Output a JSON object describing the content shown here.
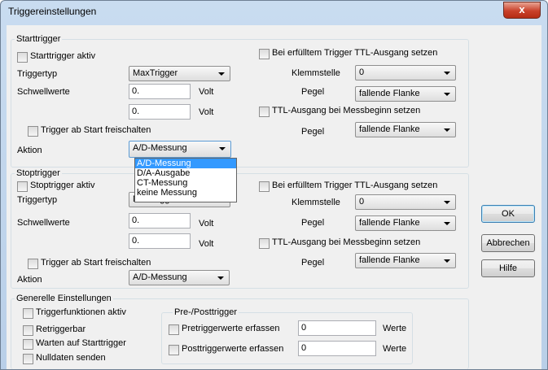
{
  "window": {
    "title": "Triggereinstellungen",
    "close_glyph": "x"
  },
  "start": {
    "group": "Starttrigger",
    "active": "Starttrigger aktiv",
    "triggertyp_label": "Triggertyp",
    "triggertyp_value": "MaxTrigger",
    "schwellwerte_label": "Schwellwerte",
    "schwellwert1": "0.",
    "schwellwert2": "0.",
    "unit": "Volt",
    "ttl_trigger": "Bei erfülltem Trigger TTL-Ausgang setzen",
    "klemmstelle_label": "Klemmstelle",
    "klemmstelle_value": "0",
    "pegel_label": "Pegel",
    "pegel_value": "fallende Flanke",
    "ttl_mess": "TTL-Ausgang bei Messbeginn setzen",
    "pegel2_value": "fallende Flanke",
    "freischalten": "Trigger ab Start freischalten",
    "aktion_label": "Aktion",
    "aktion_value": "A/D-Messung"
  },
  "dropdown": {
    "options": [
      "A/D-Messung",
      "D/A-Ausgabe",
      "CT-Messung",
      "keine Messung"
    ],
    "selected_index": 0
  },
  "stop": {
    "group": "Stoptrigger",
    "active": "Stoptrigger aktiv",
    "triggertyp_label": "Triggertyp",
    "triggertyp_value": "MaxTrigger",
    "schwellwerte_label": "Schwellwerte",
    "schwellwert1": "0.",
    "schwellwert2": "0.",
    "unit": "Volt",
    "ttl_trigger": "Bei erfülltem Trigger TTL-Ausgang setzen",
    "klemmstelle_label": "Klemmstelle",
    "klemmstelle_value": "0",
    "pegel_label": "Pegel",
    "pegel_value": "fallende Flanke",
    "ttl_mess": "TTL-Ausgang bei Messbeginn setzen",
    "pegel2_value": "fallende Flanke",
    "freischalten": "Trigger ab Start freischalten",
    "aktion_label": "Aktion",
    "aktion_value": "A/D-Messung"
  },
  "general": {
    "group": "Generelle Einstellungen",
    "triggerfunktionen": "Triggerfunktionen aktiv",
    "retriggerbar": "Retriggerbar",
    "warten": "Warten auf Starttrigger",
    "nulldaten": "Nulldaten senden",
    "prepost_group": "Pre-/Posttrigger",
    "pretrigger": "Pretriggerwerte erfassen",
    "pretrigger_value": "0",
    "posttrigger": "Posttriggerwerte erfassen",
    "posttrigger_value": "0",
    "werte": "Werte"
  },
  "buttons": {
    "ok": "OK",
    "abbrechen": "Abbrechen",
    "hilfe": "Hilfe"
  }
}
